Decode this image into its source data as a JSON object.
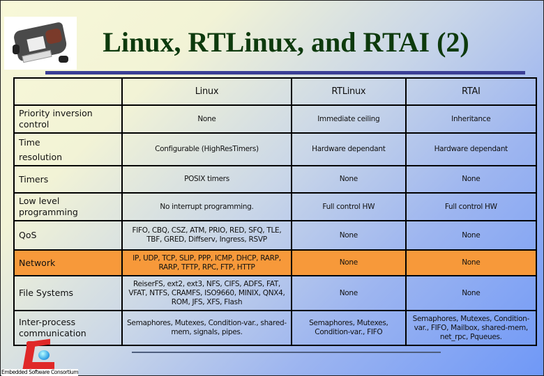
{
  "slide": {
    "title": "Linux, RTLinux, and RTAI (2)",
    "logo_text": "Embedded Software Consortium"
  },
  "table": {
    "headers": [
      "",
      "Linux",
      "RTLinux",
      "RTAI"
    ],
    "rows": [
      {
        "label": "Priority inversion control",
        "linux": "None",
        "rtlinux": "Immediate ceiling",
        "rtai": "Inheritance"
      },
      {
        "label": "Time resolution",
        "linux": "Configurable (HighResTimers)",
        "rtlinux": "Hardware dependant",
        "rtai": "Hardware dependant"
      },
      {
        "label": "Timers",
        "linux": "POSIX timers",
        "rtlinux": "None",
        "rtai": "None"
      },
      {
        "label": "Low level programming",
        "linux": "No interrupt programming.",
        "rtlinux": "Full control HW",
        "rtai": "Full control HW"
      },
      {
        "label": "QoS",
        "linux": "FIFO, CBQ, CSZ, ATM, PRIO, RED, SFQ, TLE, TBF, GRED, Diffserv, Ingress, RSVP",
        "rtlinux": "None",
        "rtai": "None"
      },
      {
        "label": "Network",
        "linux": "IP, UDP, TCP, SLIP, PPP, ICMP, DHCP, RARP, RARP, TFTP, RPC, FTP, HTTP",
        "rtlinux": "None",
        "rtai": "None",
        "highlighted": true
      },
      {
        "label": "File Systems",
        "linux": "ReiserFS, ext2, ext3, NFS, CIFS, ADFS, FAT, VFAT, NTFS, CRAMFS, ISO9660, MINIX, QNX4, ROM, JFS, XFS, Flash",
        "rtlinux": "None",
        "rtai": "None"
      },
      {
        "label": "Inter-process communication",
        "linux": "Semaphores, Mutexes, Condition-var., shared-mem, signals, pipes.",
        "rtlinux": "Semaphores, Mutexes, Condition-var., FIFO",
        "rtai": "Semaphores, Mutexes, Condition-var., FIFO, Mailbox, shared-mem, net_rpc, Pqueues."
      }
    ]
  },
  "colors": {
    "title": "#0d3a0d",
    "accent_bar": "#3b3f96",
    "highlight_row": "#f7993a"
  }
}
